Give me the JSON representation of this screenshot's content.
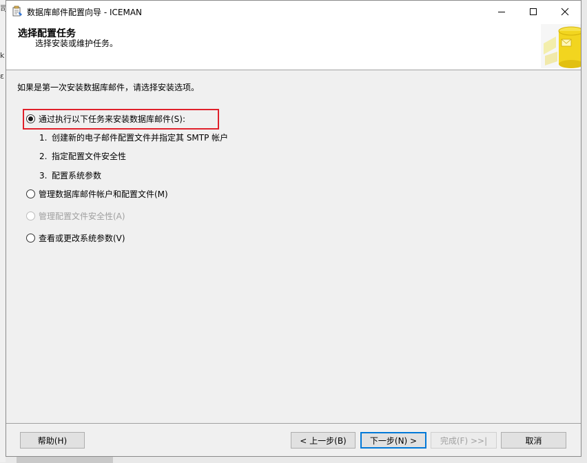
{
  "window": {
    "title": "数据库邮件配置向导 - ICEMAN",
    "app_icon": "wizard-app-icon",
    "controls": [
      "minimize-icon",
      "maximize-icon",
      "close-icon"
    ]
  },
  "header": {
    "title": "选择配置任务",
    "subtitle": "选择安装或维护任务。"
  },
  "intro": "如果是第一次安装数据库邮件，请选择安装选项。",
  "options": [
    {
      "label": "通过执行以下任务来安装数据库邮件(S):",
      "selected": true,
      "enabled": true
    },
    {
      "label": "管理数据库邮件帐户和配置文件(M)",
      "selected": false,
      "enabled": true
    },
    {
      "label": "管理配置文件安全性(A)",
      "selected": false,
      "enabled": false
    },
    {
      "label": "查看或更改系统参数(V)",
      "selected": false,
      "enabled": true
    }
  ],
  "steps": [
    {
      "num": "1.",
      "text": "创建新的电子邮件配置文件并指定其 SMTP 帐户"
    },
    {
      "num": "2.",
      "text": "指定配置文件安全性"
    },
    {
      "num": "3.",
      "text": "配置系统参数"
    }
  ],
  "buttons": {
    "help": "帮助(H)",
    "back": "< 上一步(B)",
    "next": "下一步(N) >",
    "finish": "完成(F) >>|",
    "cancel": "取消"
  },
  "background_fragments": [
    "司",
    "k",
    "ε"
  ],
  "colors": {
    "highlight": "#e0202a",
    "focus": "#0078d7",
    "disabled_text": "#a0a0a0"
  }
}
